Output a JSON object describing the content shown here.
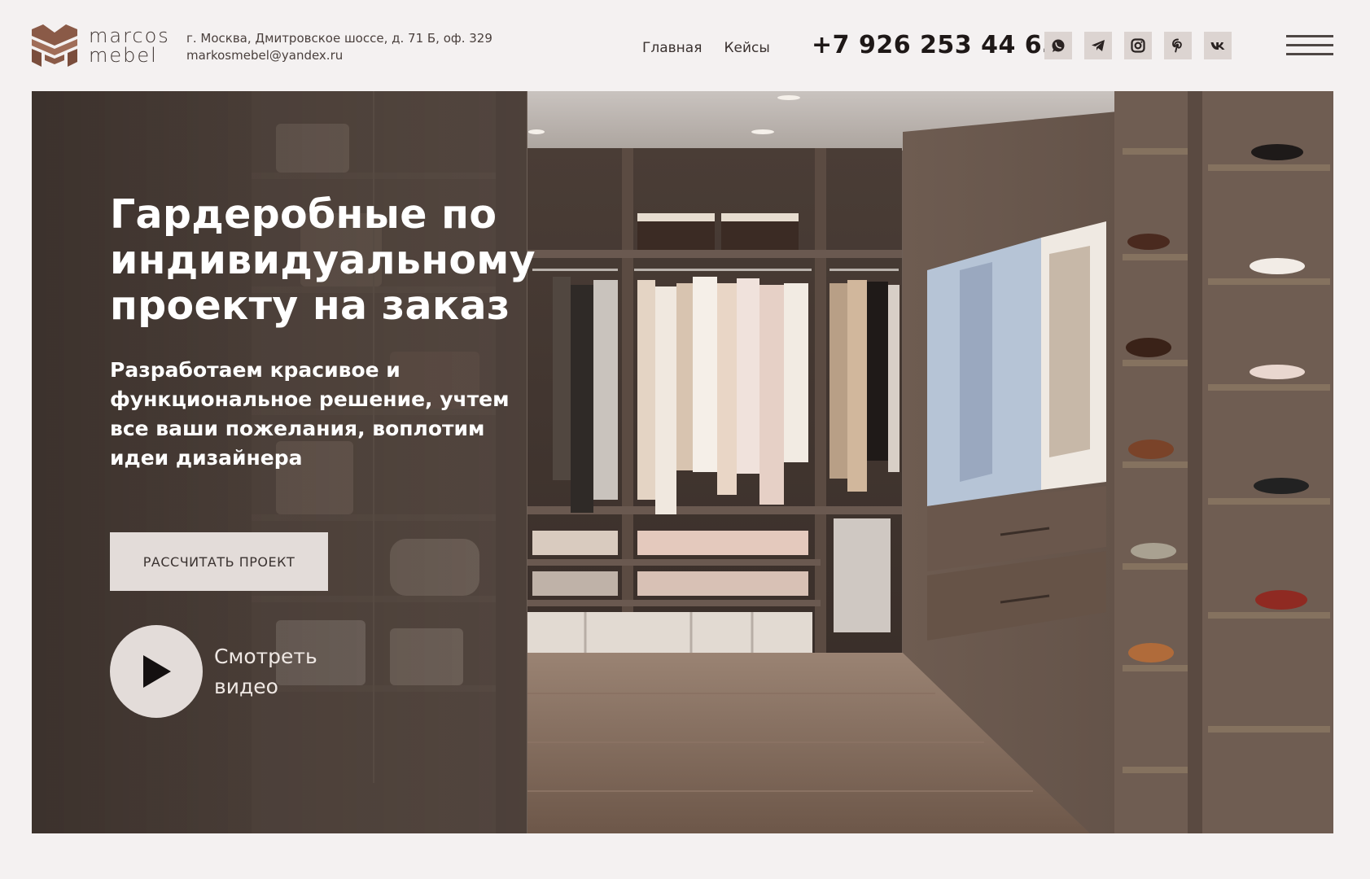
{
  "header": {
    "logo": {
      "line1": "marcos",
      "line2": "mebel"
    },
    "address": "г. Москва, Дмитровское шоссе, д. 71 Б, оф. 329",
    "email": "markosmebel@yandex.ru",
    "nav": [
      {
        "label": "Главная"
      },
      {
        "label": "Кейсы"
      }
    ],
    "phone": "+7 926 253 44 65",
    "socials": [
      "whatsapp-icon",
      "telegram-icon",
      "instagram-icon",
      "pinterest-icon",
      "vk-icon"
    ]
  },
  "hero": {
    "title": "Гардеробные по индивидуальному проекту на заказ",
    "subtitle": "Разработаем красивое и функциональное решение, учтем все ваши пожелания, воплотим идеи дизайнера",
    "cta_label": "РАССЧИТАТЬ ПРОЕКТ",
    "video_label": "Смотреть видео"
  },
  "colors": {
    "page_bg": "#f4f1f1",
    "logo_brown": "#8a5a47",
    "panel_dark": "#3f3530",
    "button_bg": "#e3dcd9",
    "social_bg": "#dcd4d1"
  }
}
